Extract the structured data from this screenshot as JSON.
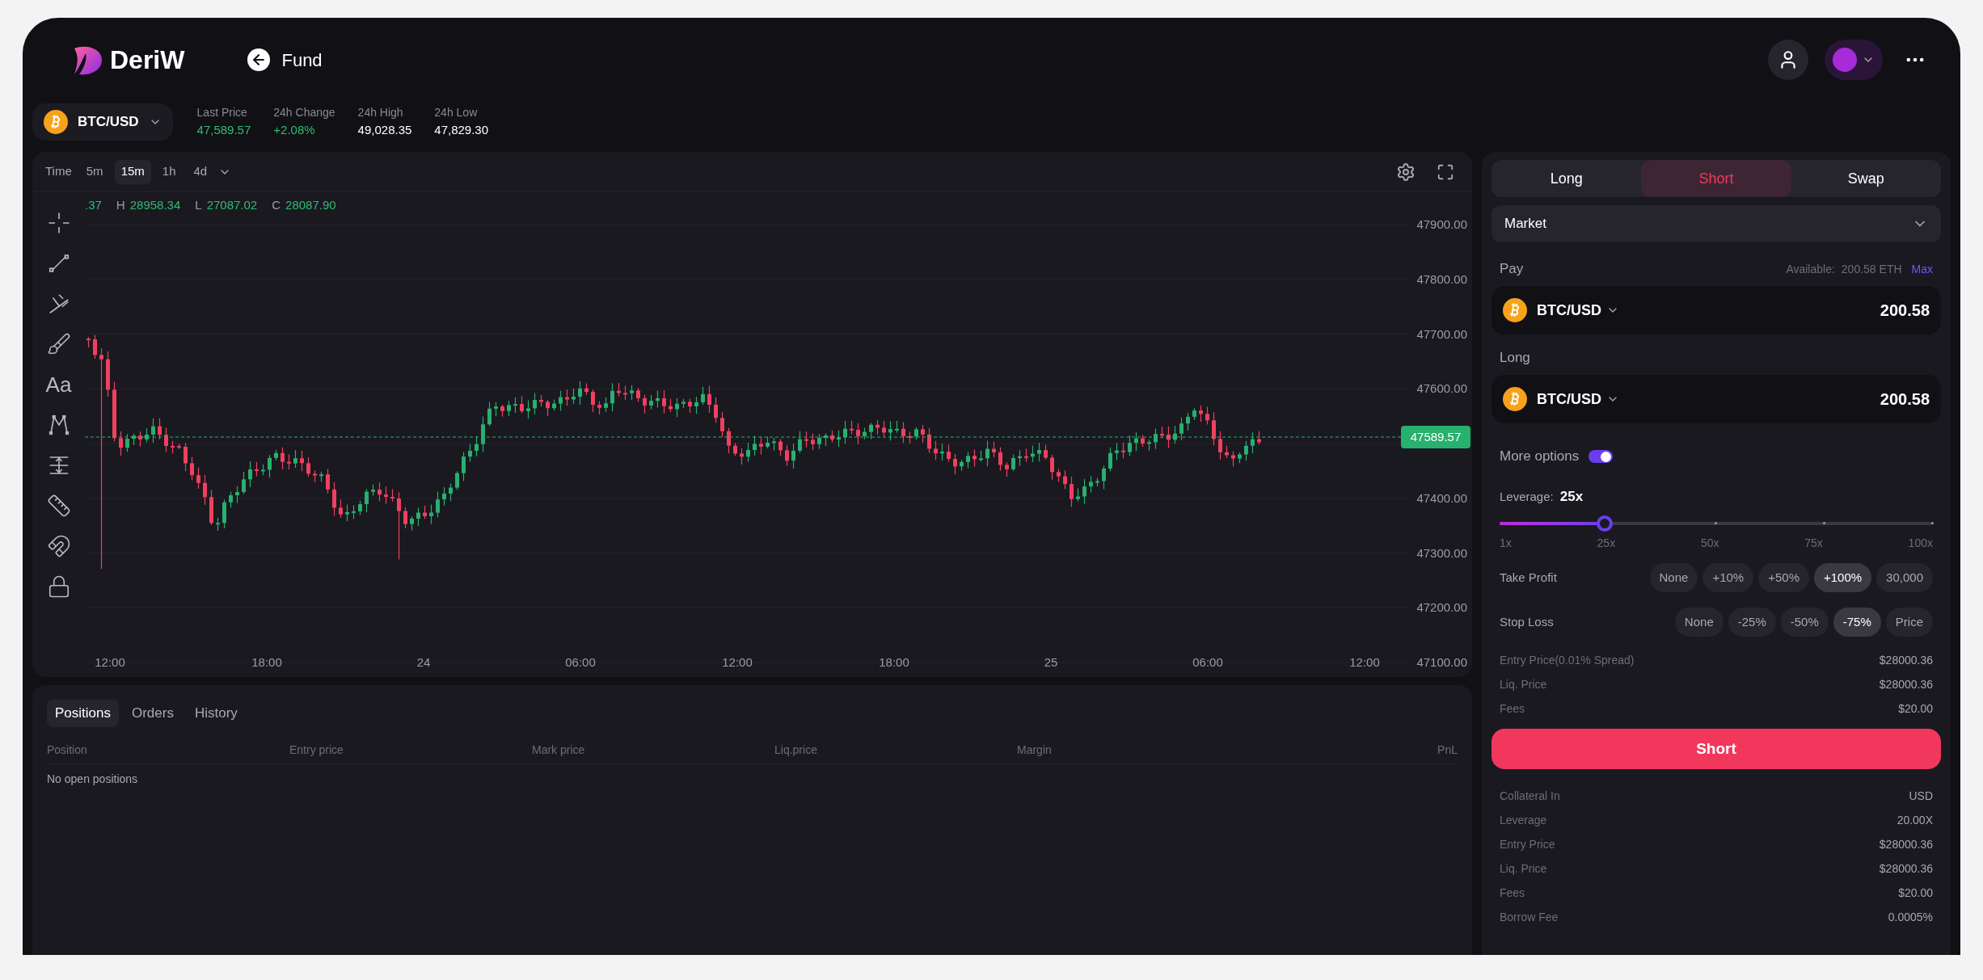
{
  "header": {
    "logo_text": "DeriW",
    "back_label": "Fund"
  },
  "market": {
    "pair": "BTC/USD",
    "stats": [
      {
        "label": "Last Price",
        "value": "47,589.57",
        "color": "#2ebd71"
      },
      {
        "label": "24h Change",
        "value": "+2.08%",
        "color": "#2ebd71"
      },
      {
        "label": "24h High",
        "value": "49,028.35",
        "color": "#ffffff"
      },
      {
        "label": "24h Low",
        "value": "47,829.30",
        "color": "#ffffff"
      }
    ]
  },
  "chart": {
    "time_label": "Time",
    "intervals": [
      {
        "label": "5m",
        "selected": false
      },
      {
        "label": "15m",
        "selected": true
      },
      {
        "label": "1h",
        "selected": false
      },
      {
        "label": "4d",
        "selected": false
      }
    ],
    "ohlc": [
      {
        "value": ".37"
      },
      {
        "label": "H",
        "value": "28958.34"
      },
      {
        "label": "L",
        "value": "27087.02"
      },
      {
        "label": "C",
        "value": "28087.90"
      }
    ],
    "text_tool": "Aa",
    "y_axis": [
      "47900.00",
      "47800.00",
      "47700.00",
      "47600.00",
      "47400.00",
      "47300.00",
      "47200.00",
      "47100.00"
    ],
    "x_axis": [
      "12:00",
      "18:00",
      "24",
      "06:00",
      "12:00",
      "18:00",
      "25",
      "06:00",
      "12:00"
    ],
    "last_price": "47589.57"
  },
  "positions": {
    "tabs": [
      {
        "label": "Positions",
        "selected": true
      },
      {
        "label": "Orders",
        "selected": false
      },
      {
        "label": "History",
        "selected": false
      }
    ],
    "columns": [
      "Position",
      "Entry price",
      "Mark price",
      "Liq.price",
      "Margin",
      "PnL"
    ],
    "empty_message": "No open positions"
  },
  "order": {
    "tabs": [
      {
        "label": "Long",
        "selected": false
      },
      {
        "label": "Short",
        "selected": true
      },
      {
        "label": "Swap",
        "selected": false
      }
    ],
    "order_type": "Market",
    "pay": {
      "label": "Pay",
      "available_label": "Available:",
      "available": "200.58 ETH",
      "max": "Max",
      "token": "BTC/USD",
      "amount": "200.58"
    },
    "receive": {
      "label": "Long",
      "token": "BTC/USD",
      "amount": "200.58"
    },
    "more_options": {
      "label": "More options",
      "on": true
    },
    "leverage": {
      "label": "Leverage:",
      "value": "25x",
      "level": 0.242,
      "ticks": [
        "1x",
        "25x",
        "50x",
        "75x",
        "100x"
      ]
    },
    "take_profit": {
      "label": "Take Profit",
      "options": [
        {
          "label": "None",
          "selected": false
        },
        {
          "label": "+10%",
          "selected": false
        },
        {
          "label": "+50%",
          "selected": false
        },
        {
          "label": "+100%",
          "selected": true
        },
        {
          "label": "30,000",
          "selected": false
        }
      ]
    },
    "stop_loss": {
      "label": "Stop Loss",
      "options": [
        {
          "label": "None",
          "selected": false
        },
        {
          "label": "-25%",
          "selected": false
        },
        {
          "label": "-50%",
          "selected": false
        },
        {
          "label": "-75%",
          "selected": true
        },
        {
          "label": "Price",
          "selected": false
        }
      ]
    },
    "summary": [
      {
        "label": "Entry Price(0.01% Spread)",
        "value": "$28000.36"
      },
      {
        "label": "Liq. Price",
        "value": "$28000.36"
      },
      {
        "label": "Fees",
        "value": "$20.00"
      }
    ],
    "submit": "Short",
    "details": [
      {
        "label": "Collateral In",
        "value": "USD"
      },
      {
        "label": "Leverage",
        "value": "20.00X"
      },
      {
        "label": "Entry Price",
        "value": "$28000.36"
      },
      {
        "label": "Liq. Price",
        "value": "$28000.36"
      },
      {
        "label": "Fees",
        "value": "$20.00"
      },
      {
        "label": "Borrow Fee",
        "value": "0.0005%"
      }
    ]
  }
}
